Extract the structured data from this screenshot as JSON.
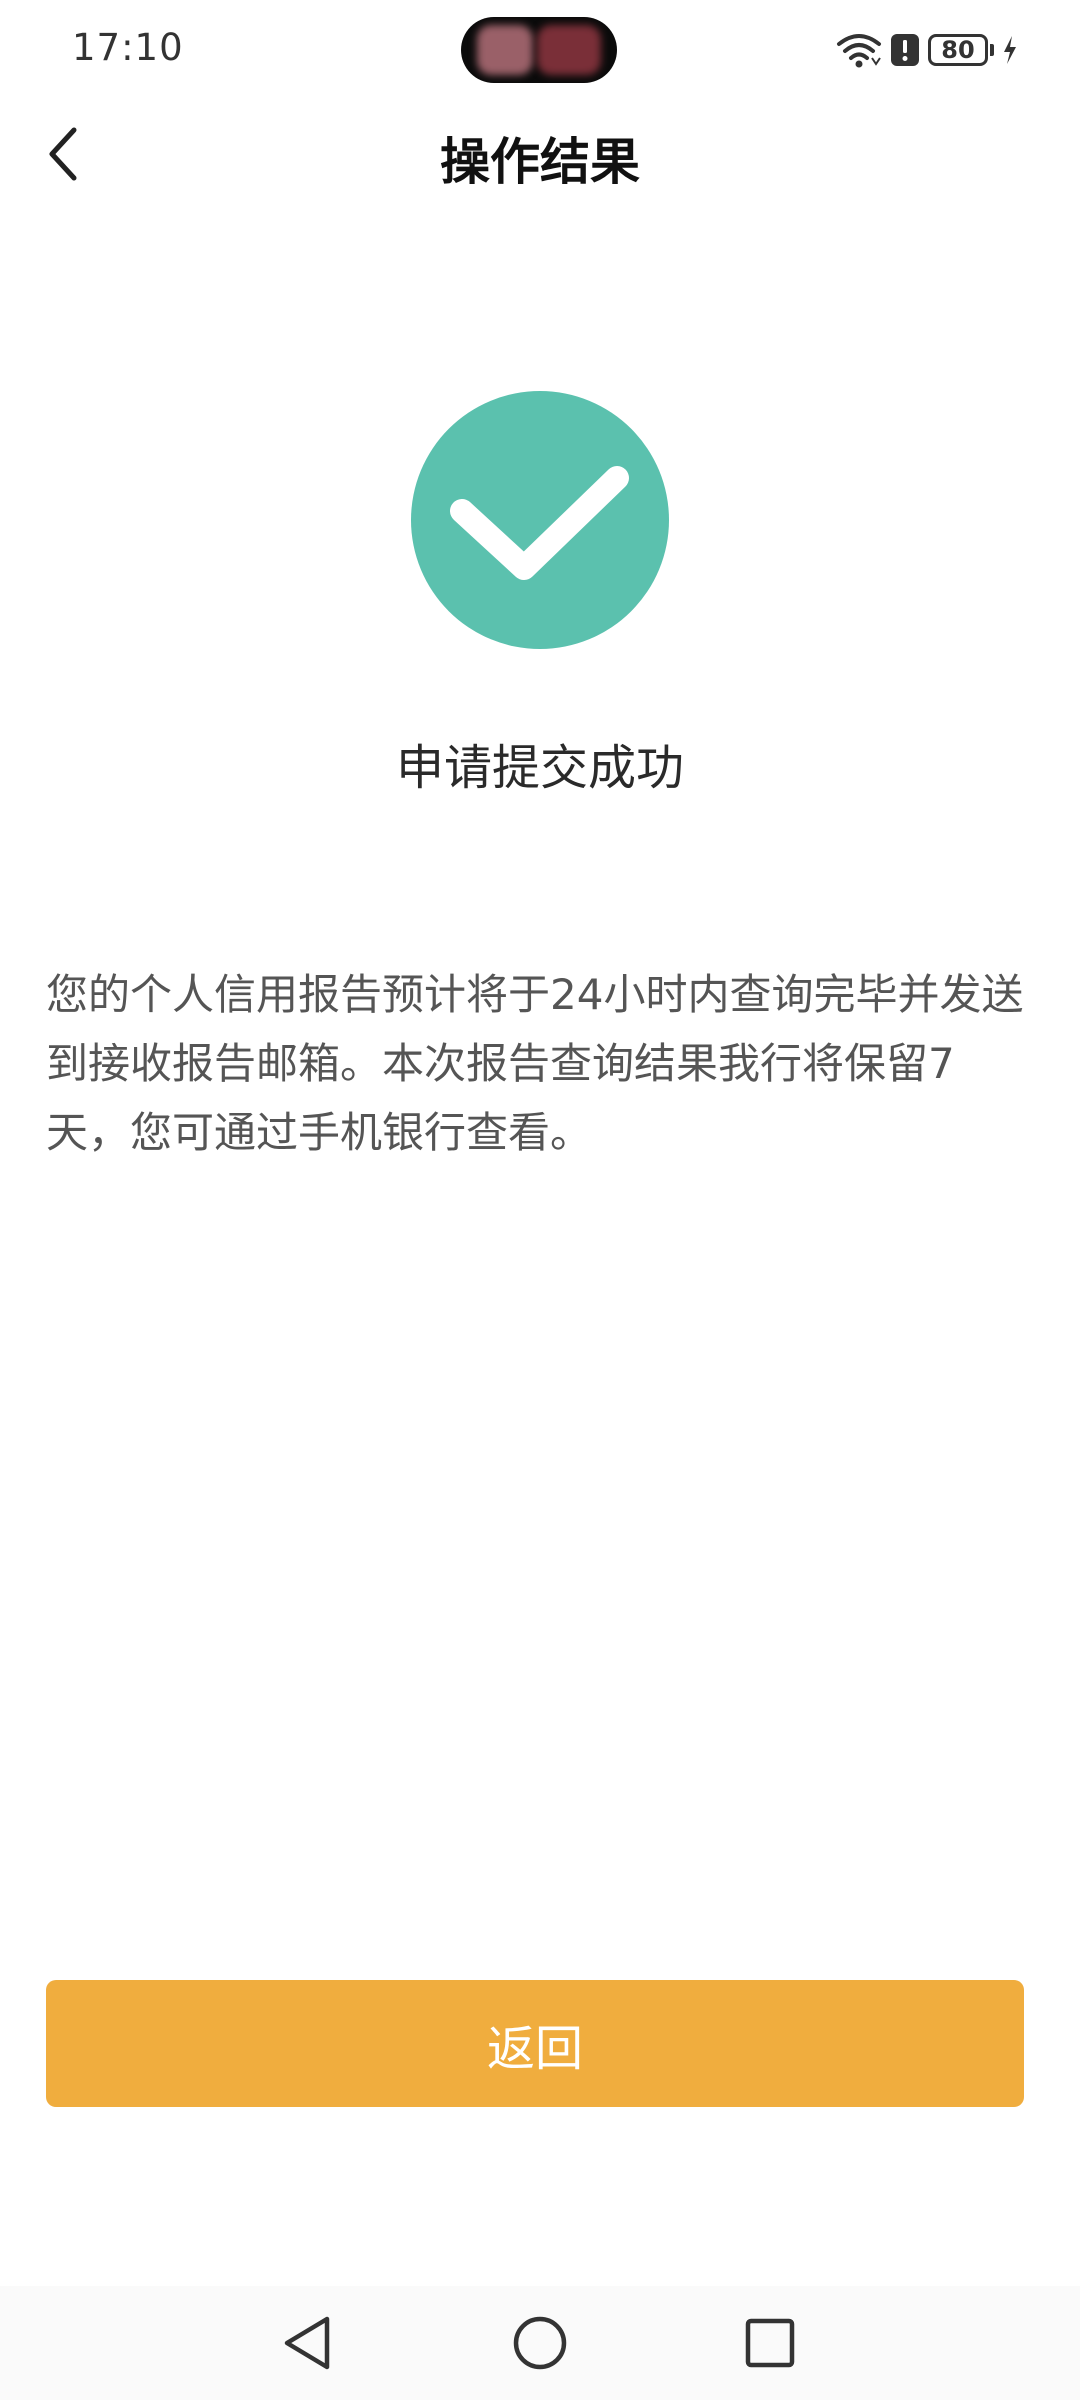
{
  "status_bar": {
    "time": "17:10",
    "battery": "80",
    "icons": [
      "wifi-icon",
      "alert-icon",
      "battery-icon",
      "charging-icon"
    ]
  },
  "header": {
    "title": "操作结果",
    "back_icon": "chevron-left-icon"
  },
  "result": {
    "icon": "check-circle-icon",
    "icon_color": "#5BC1AE",
    "title": "申请提交成功",
    "description": "您的个人信用报告预计将于24小时内查询完毕并发送到接收报告邮箱。本次报告查询结果我行将保留7天，您可通过手机银行查看。"
  },
  "actions": {
    "back_label": "返回",
    "button_color": "#F0AD3E"
  },
  "nav_bar": {
    "icons": [
      "nav-back-icon",
      "nav-home-icon",
      "nav-recents-icon"
    ]
  }
}
